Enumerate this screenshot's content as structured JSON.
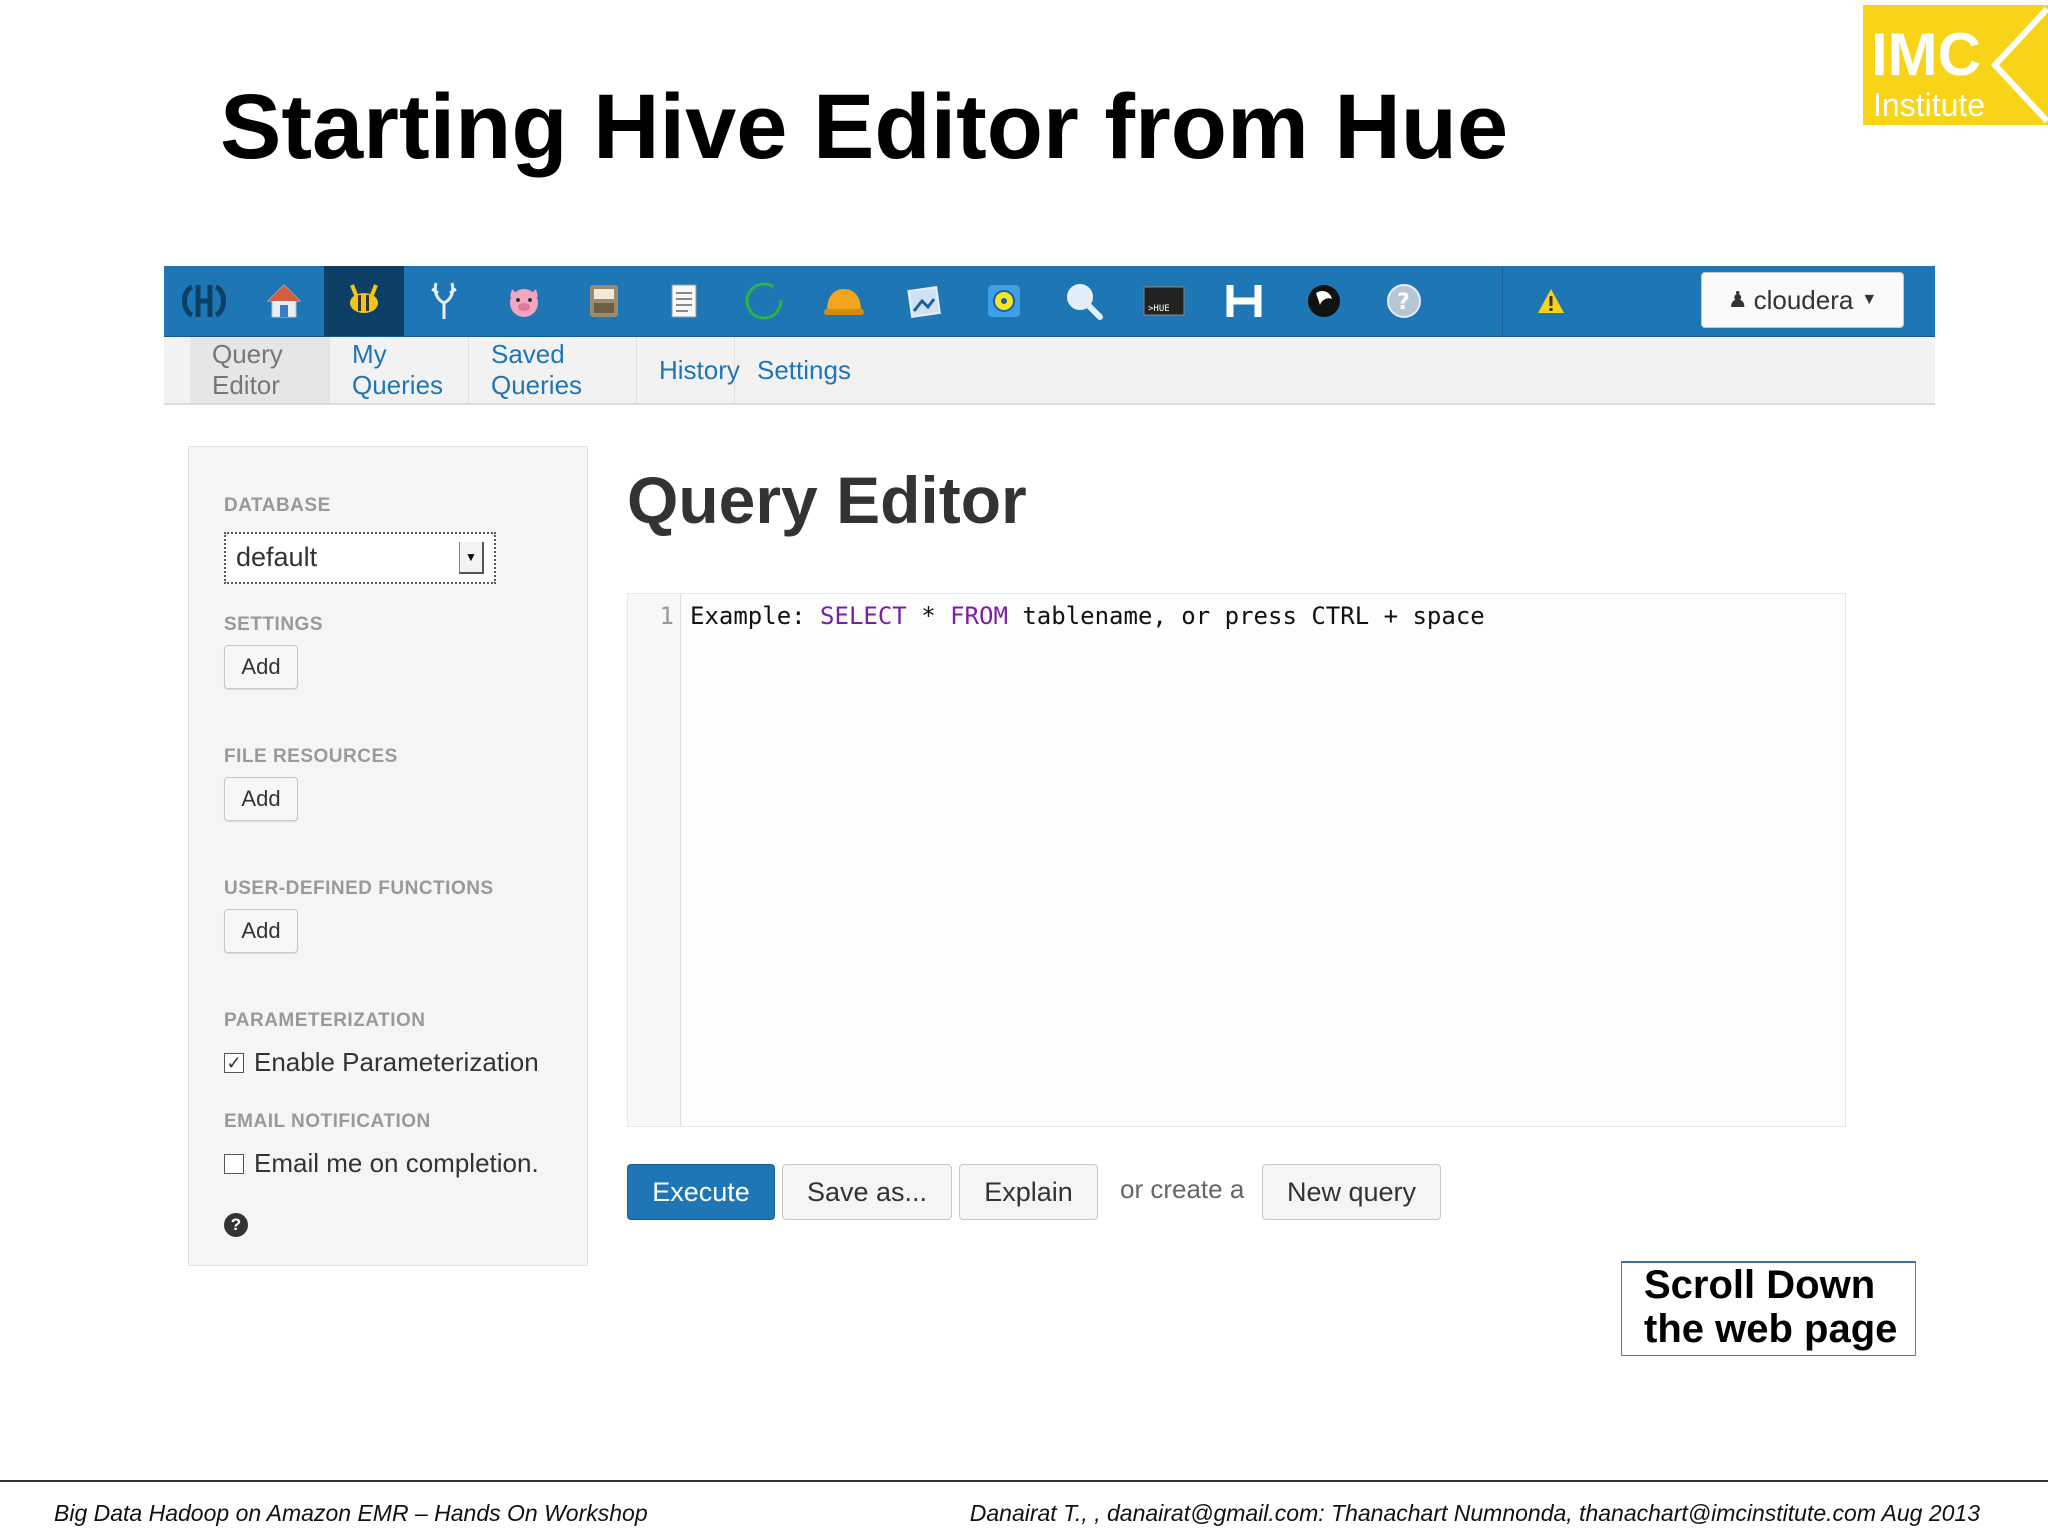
{
  "slide": {
    "title": "Starting Hive Editor from Hue",
    "logo_top": "IMC",
    "logo_bottom": "Institute"
  },
  "topnav": {
    "icons": [
      "hue-logo-icon",
      "home-icon",
      "hive-bee-icon",
      "impala-antler-icon",
      "pig-icon",
      "job-browser-icon",
      "document-icon",
      "oozie-refresh-icon",
      "hardhat-icon",
      "image-icon",
      "sqoop-target-icon",
      "search-icon",
      "hue-shell-icon",
      "hbase-h-icon",
      "zookeeper-icon",
      "help-icon",
      "warning-icon"
    ],
    "user_label": "cloudera"
  },
  "subnav": {
    "tabs": [
      "Query Editor",
      "My Queries",
      "Saved Queries",
      "History",
      "Settings"
    ]
  },
  "sidebar": {
    "database_header": "DATABASE",
    "database_value": "default",
    "settings_header": "SETTINGS",
    "settings_add": "Add",
    "file_resources_header": "FILE RESOURCES",
    "file_resources_add": "Add",
    "udf_header": "USER-DEFINED FUNCTIONS",
    "udf_add": "Add",
    "parameterization_header": "PARAMETERIZATION",
    "parameterization_label": "Enable Parameterization",
    "parameterization_checked": true,
    "email_header": "EMAIL NOTIFICATION",
    "email_label": "Email me on completion.",
    "email_checked": false
  },
  "main": {
    "title": "Query Editor",
    "editor": {
      "line_number": "1",
      "code_prefix": "Example: ",
      "kw_select": "SELECT",
      "code_mid1": " * ",
      "kw_from": "FROM",
      "code_suffix": " tablename, or press CTRL + space"
    },
    "buttons": {
      "execute": "Execute",
      "save_as": "Save as...",
      "explain": "Explain",
      "or_create": "or create a",
      "new_query": "New query"
    }
  },
  "callout": {
    "line1": "Scroll Down",
    "line2": "the web page"
  },
  "footer": {
    "left": "Big Data Hadoop on Amazon EMR – Hands On Workshop",
    "right": "Danairat T., , danairat@gmail.com:  Thanachart Numnonda,  thanachart@imcinstitute.com   Aug 2013"
  },
  "colors": {
    "nav_blue": "#1f76b5",
    "logo_yellow": "#f7d417",
    "keyword_purple": "#7a1fa2"
  }
}
